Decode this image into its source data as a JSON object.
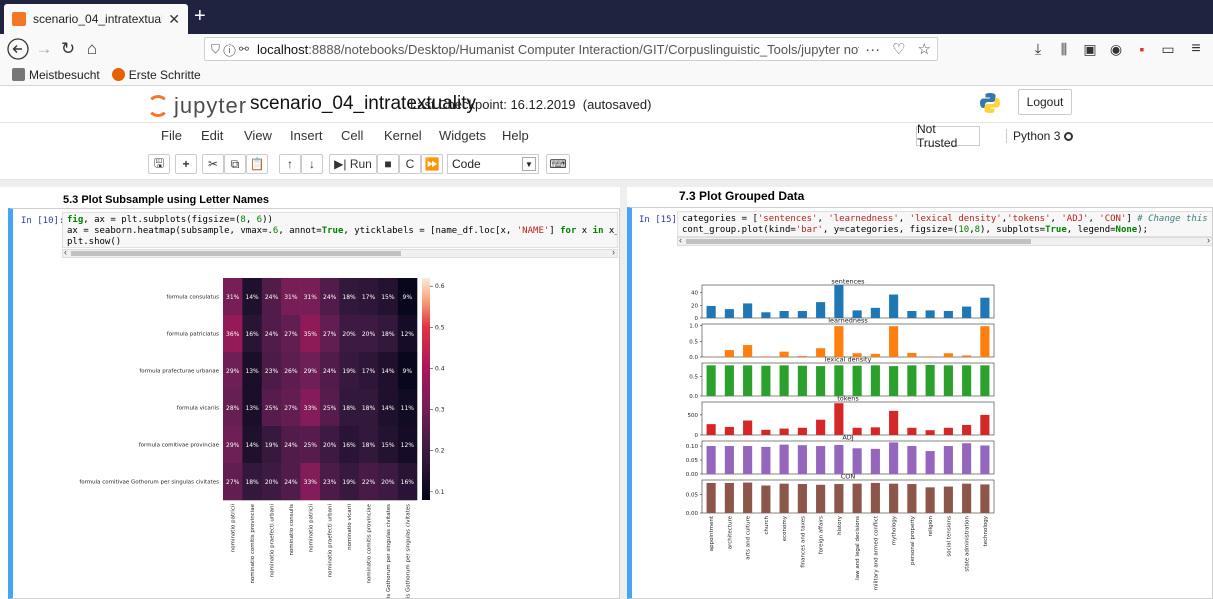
{
  "browser": {
    "tab_title": "scenario_04_intratextuality - Jup",
    "url_prefix": "localhost",
    "url_rest": ":8888/notebooks/Desktop/Humanist Computer Interaction/GIT/Corpuslinguistic_Tools/jupyter notebook",
    "bookmarks": [
      "Meistbesucht",
      "Erste Schritte"
    ]
  },
  "jupyter": {
    "logo_text": "jupyter",
    "notebook_name": "scenario_04_intratextuality",
    "checkpoint": "Last Checkpoint: 16.12.2019",
    "autosaved": "(autosaved)",
    "logout_label": "Logout",
    "menu": [
      "File",
      "Edit",
      "View",
      "Insert",
      "Cell",
      "Kernel",
      "Widgets",
      "Help"
    ],
    "trust_label": "Not Trusted",
    "kernel_label": "Python 3",
    "run_label": "Run",
    "cell_type": "Code"
  },
  "left_cell": {
    "title": "5.3 Plot Subsample using Letter Names",
    "prompt": "In [10]:",
    "code_lines": [
      "fig, ax = plt.subplots(figsize=(8, 6))",
      "ax = seaborn.heatmap(subsample, vmax=.6, annot=True, yticklabels = [name_df.loc[x, 'NAME'] for x in x_values], xticklabe",
      "plt.show()"
    ]
  },
  "right_cell": {
    "title": "7.3 Plot Grouped Data",
    "prompt": "In [15]:",
    "code_lines": [
      "categories = ['sentences', 'learnedness', 'lexical density','tokens', 'ADJ', 'CON'] # Change this list to plot differen",
      "cont_group.plot(kind='bar', y=categories, figsize=(10,8), subplots=True, legend=None);"
    ]
  },
  "chart_data": [
    {
      "type": "heatmap",
      "title": "",
      "rows": [
        "formula consulatus",
        "formula patriciatus",
        "formula prafecturae urbanae",
        "formula vicariis",
        "formula comitivae provinciae",
        "formula comitivae Gothorum per singulas civitates"
      ],
      "columns": [
        "nominatio patricii",
        "nominatio comitis provinciae",
        "nominatio praefecti urbani",
        "nominatio consulis",
        "nominatio patricii",
        "nominatio praefecti urbani",
        "nominatio vicarii",
        "nominatio comitis provinciae",
        "comitis Gothorum per singulas civitates",
        "comitis Gothorum per singulas civitates"
      ],
      "values": [
        [
          31,
          14,
          24,
          31,
          31,
          24,
          18,
          17,
          15,
          9
        ],
        [
          36,
          16,
          24,
          27,
          35,
          27,
          20,
          20,
          18,
          12
        ],
        [
          29,
          13,
          23,
          26,
          29,
          24,
          19,
          17,
          14,
          9
        ],
        [
          28,
          13,
          25,
          27,
          33,
          25,
          18,
          18,
          14,
          11
        ],
        [
          29,
          14,
          19,
          24,
          25,
          20,
          16,
          18,
          15,
          12
        ],
        [
          27,
          18,
          20,
          24,
          33,
          23,
          19,
          22,
          20,
          16
        ]
      ],
      "cell_labels": [
        [
          "31%",
          "14%",
          "24%",
          "31%",
          "31%",
          "24%",
          "18%",
          "17%",
          "15%",
          "9%"
        ],
        [
          "36%",
          "16%",
          "24%",
          "27%",
          "35%",
          "27%",
          "20%",
          "20%",
          "18%",
          "12%"
        ],
        [
          "29%",
          "13%",
          "23%",
          "26%",
          "29%",
          "24%",
          "19%",
          "17%",
          "14%",
          "9%"
        ],
        [
          "28%",
          "13%",
          "25%",
          "27%",
          "33%",
          "25%",
          "18%",
          "18%",
          "14%",
          "11%"
        ],
        [
          "29%",
          "14%",
          "19%",
          "24%",
          "25%",
          "20%",
          "16%",
          "18%",
          "15%",
          "12%"
        ],
        [
          "27%",
          "18%",
          "20%",
          "24%",
          "33%",
          "23%",
          "19%",
          "22%",
          "20%",
          "16%"
        ]
      ],
      "colorbar_ticks": [
        "0.6",
        "0.5",
        "0.4",
        "0.3",
        "0.2",
        "0.1"
      ],
      "colorbar_range": [
        0.08,
        0.62
      ],
      "colormap": "rocket"
    },
    {
      "type": "bar",
      "categories": [
        "appointment",
        "architecture",
        "arts and culture",
        "church",
        "economy",
        "finances and taxes",
        "foreign affairs",
        "history",
        "law and legal decisions",
        "military and armed conflict",
        "mythology",
        "personal property",
        "religion",
        "social tensions",
        "state administration",
        "technology"
      ],
      "series": [
        {
          "name": "sentences",
          "color": "#1f77b4",
          "values": [
            19,
            14,
            23,
            9,
            11,
            11,
            25,
            52,
            12,
            16,
            37,
            11,
            12,
            11,
            18,
            32
          ],
          "ylim": [
            0,
            52
          ],
          "ticks": [
            "0",
            "20",
            "40"
          ]
        },
        {
          "name": "learnedness",
          "color": "#ff7f0e",
          "values": [
            0.01,
            0.22,
            0.38,
            0.02,
            0.17,
            0.03,
            0.28,
            0.98,
            0.12,
            0.1,
            0.98,
            0.13,
            0.02,
            0.12,
            0.05,
            0.98
          ],
          "ylim": [
            0,
            1.05
          ],
          "ticks": [
            "0.0",
            "0.5",
            "1.0"
          ]
        },
        {
          "name": "lexical density",
          "color": "#2ca02c",
          "values": [
            0.79,
            0.79,
            0.79,
            0.78,
            0.79,
            0.78,
            0.77,
            0.79,
            0.78,
            0.79,
            0.77,
            0.79,
            0.8,
            0.79,
            0.79,
            0.79
          ],
          "ylim": [
            0,
            0.85
          ],
          "ticks": [
            "0.0",
            "0.5"
          ]
        },
        {
          "name": "tokens",
          "color": "#d62728",
          "values": [
            270,
            200,
            360,
            130,
            160,
            180,
            380,
            790,
            180,
            190,
            600,
            180,
            120,
            180,
            250,
            500
          ],
          "ylim": [
            0,
            820
          ],
          "ticks": [
            "0",
            "500"
          ]
        },
        {
          "name": "ADJ",
          "color": "#9467bd",
          "values": [
            0.1,
            0.1,
            0.1,
            0.097,
            0.105,
            0.103,
            0.1,
            0.104,
            0.092,
            0.09,
            0.113,
            0.1,
            0.082,
            0.1,
            0.11,
            0.102
          ],
          "ylim": [
            0,
            0.118
          ],
          "ticks": [
            "0.00",
            "0.05",
            "0.10"
          ]
        },
        {
          "name": "CON",
          "color": "#8c564b",
          "values": [
            0.082,
            0.082,
            0.083,
            0.075,
            0.08,
            0.079,
            0.077,
            0.079,
            0.08,
            0.082,
            0.08,
            0.079,
            0.07,
            0.072,
            0.08,
            0.078
          ],
          "ylim": [
            0,
            0.09
          ],
          "ticks": [
            "0.00",
            "0.05"
          ]
        }
      ],
      "legend": "none"
    }
  ]
}
